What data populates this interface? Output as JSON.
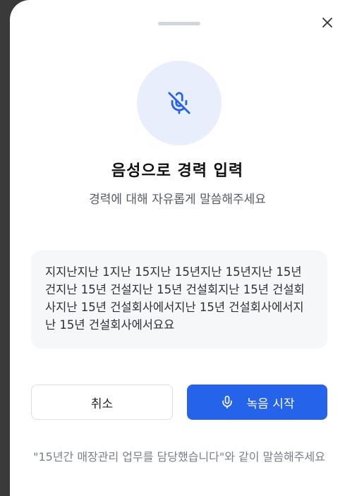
{
  "sheet": {
    "title": "음성으로 경력 입력",
    "subtitle": "경력에 대해 자유롭게 말씀해주세요",
    "transcript": "지지난지난 1지난 15지난 15년지난 15년지난 15년 건지난 15년 건설지난 15년 건설회지난 15년 건설회사지난 15년 건설회사에서지난 15년 건설회사에서지난 15년 건설회사에서요요",
    "buttons": {
      "cancel_label": "취소",
      "record_label": "녹음 시작"
    },
    "hint": "\"15년간 매장관리 업무를 담당했습니다\"와 같이 말씀해주세요"
  },
  "icons": {
    "close": "close-icon",
    "mic_off": "mic-off-icon",
    "mic": "mic-icon"
  },
  "colors": {
    "accent": "#2563eb",
    "mic_circle_bg": "#e8eefc"
  }
}
